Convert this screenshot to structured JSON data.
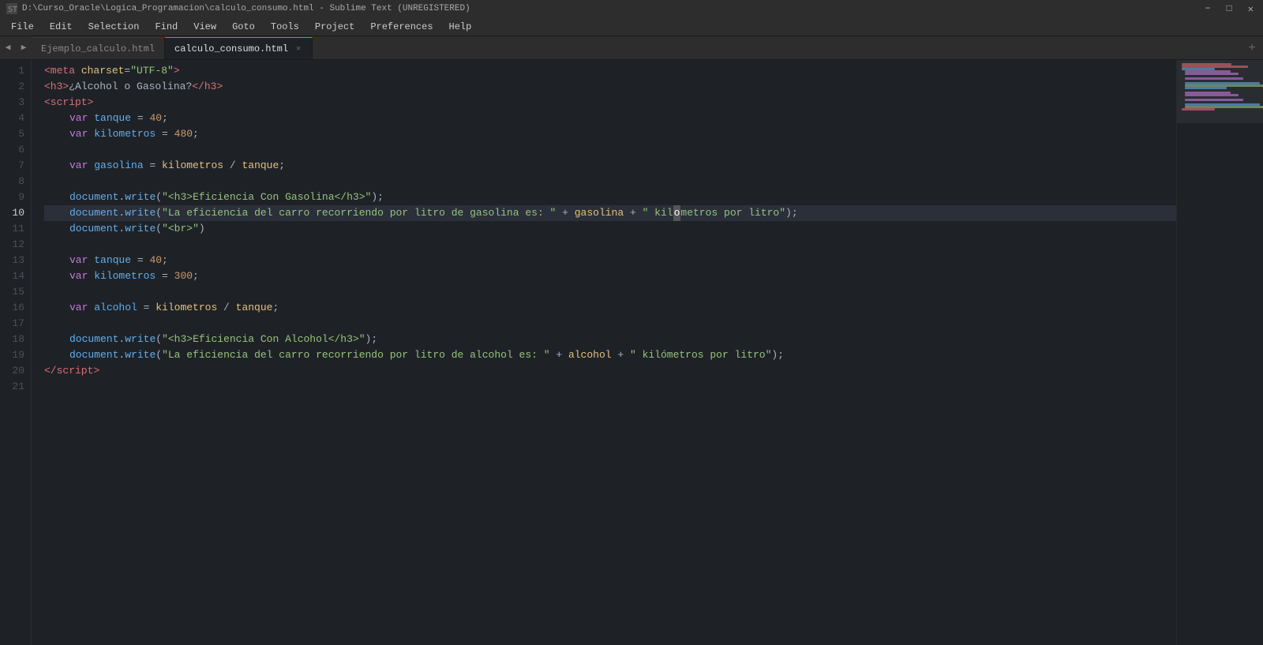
{
  "title_bar": {
    "title": "D:\\Curso_Oracle\\Logica_Programacion\\calculo_consumo.html - Sublime Text (UNREGISTERED)",
    "icon": "ST"
  },
  "menu": {
    "items": [
      "File",
      "Edit",
      "Selection",
      "Find",
      "View",
      "Goto",
      "Tools",
      "Project",
      "Preferences",
      "Help"
    ]
  },
  "tabs": [
    {
      "label": "Ejemplo_calculo.html",
      "active": false,
      "closeable": false
    },
    {
      "label": "calculo_consumo.html",
      "active": true,
      "closeable": true
    }
  ],
  "lines": [
    {
      "num": 1,
      "content": ""
    },
    {
      "num": 2,
      "content": ""
    },
    {
      "num": 3,
      "content": ""
    },
    {
      "num": 4,
      "content": ""
    },
    {
      "num": 5,
      "content": ""
    },
    {
      "num": 6,
      "content": ""
    },
    {
      "num": 7,
      "content": ""
    },
    {
      "num": 8,
      "content": ""
    },
    {
      "num": 9,
      "content": ""
    },
    {
      "num": 10,
      "content": "",
      "highlighted": true
    },
    {
      "num": 11,
      "content": ""
    },
    {
      "num": 12,
      "content": ""
    },
    {
      "num": 13,
      "content": ""
    },
    {
      "num": 14,
      "content": ""
    },
    {
      "num": 15,
      "content": ""
    },
    {
      "num": 16,
      "content": ""
    },
    {
      "num": 17,
      "content": ""
    },
    {
      "num": 18,
      "content": ""
    },
    {
      "num": 19,
      "content": ""
    },
    {
      "num": 20,
      "content": ""
    },
    {
      "num": 21,
      "content": ""
    }
  ],
  "minimap_label": "minimap"
}
